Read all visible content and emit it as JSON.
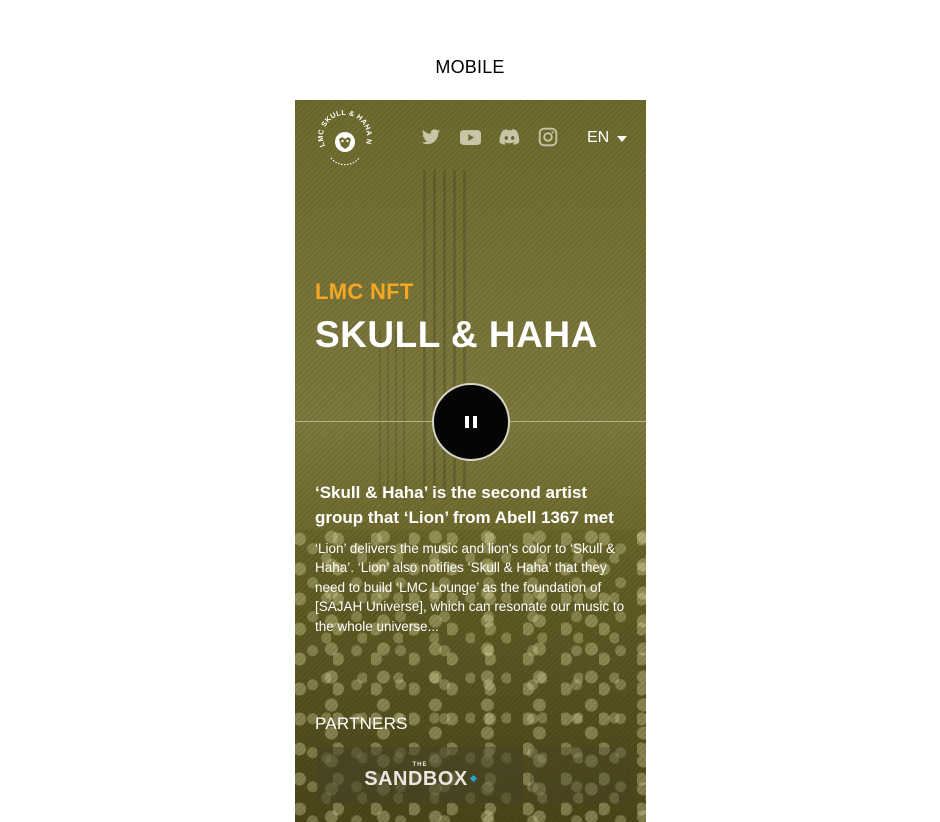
{
  "caption": "MOBILE",
  "header": {
    "logo_text": "LMC SKULL & HAHA NFT",
    "social_icons": [
      "twitter-icon",
      "youtube-icon",
      "discord-icon",
      "instagram-icon"
    ],
    "language": "EN"
  },
  "hero": {
    "eyebrow": "LMC NFT",
    "title": "SKULL & HAHA",
    "player_state": "pause-icon"
  },
  "story": {
    "subhead": "‘Skull & Haha’ is the second artist group that ‘Lion’ from Abell 1367 met",
    "body": "‘Lion’ delivers the music and lion's color to ‘Skull & Haha’. ‘Lion’ also notifies ‘Skull & Haha’ that they need to build ‘LMC Lounge’ as the foundation of [SAJAH Universe], which can resonate our music to the whole universe..."
  },
  "partners": {
    "heading": "PARTNERS",
    "items": [
      {
        "prefix": "THE",
        "name": "SANDBOX"
      }
    ]
  },
  "colors": {
    "accent": "#f5a623",
    "overlay": "#6f6a2c",
    "text": "#ffffff",
    "sandbox_dot": "#23a6d5"
  }
}
